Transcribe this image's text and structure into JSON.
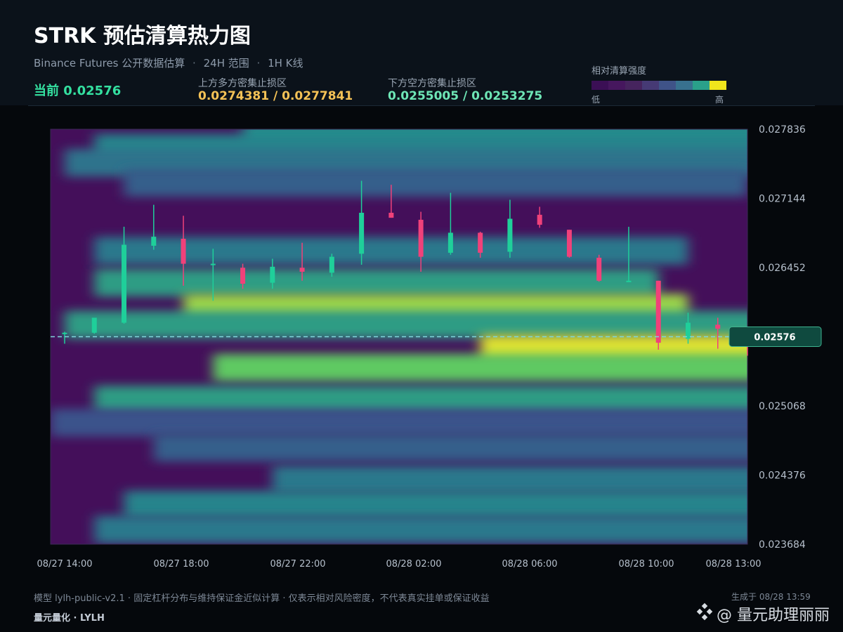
{
  "header": {
    "title": "STRK 预估清算热力图",
    "subtitle_parts": [
      "Binance Futures 公开数据估算",
      "24H 范围",
      "1H K线"
    ],
    "separator": "·",
    "current_label": "当前 0.02576",
    "upper_zone_label": "上方多方密集止损区",
    "upper_zone_value": "0.0274381 / 0.0277841",
    "lower_zone_label": "下方空方密集止损区",
    "lower_zone_value": "0.0255005 / 0.0253275",
    "legend_title": "相对清算强度",
    "legend_low": "低",
    "legend_high": "高"
  },
  "colors": {
    "background": "#05080c",
    "header_bg": "#0b121a",
    "up_candle": "#1fcf9a",
    "down_candle": "#f0417a",
    "current_line": "#7fd6dc",
    "upper_zone": "#f5c256",
    "lower_zone": "#6ee6b6",
    "legend": [
      "#3b0f55",
      "#46175e",
      "#46245e",
      "#463a75",
      "#3f5388",
      "#38718f",
      "#2aa08a",
      "#f0e51c"
    ]
  },
  "footer": {
    "note": "模型 lylh-public-v2.1 · 固定杠杆分布与维持保证金近似计算 · 仅表示相对风险密度，不代表真实挂单或保证收益",
    "generated": "生成于 08/28 13:59",
    "brand": "量元量化 · LYLH",
    "watermark": "@ 量元助理丽丽"
  },
  "chart_data": {
    "type": "heatmap",
    "title": "STRK 预估清算热力图",
    "ylim": [
      0.023684,
      0.027836
    ],
    "y_ticks": [
      "0.027836",
      "0.027144",
      "0.026452",
      "0.025760",
      "0.025068",
      "0.024376",
      "0.023684"
    ],
    "x_ticks": [
      "08/27 14:00",
      "08/27 18:00",
      "08/27 22:00",
      "08/28 02:00",
      "08/28 06:00",
      "08/28 10:00",
      "08/28 13:00"
    ],
    "current_price": 0.02576,
    "current_price_label": "0.02576",
    "candles": [
      {
        "t": "08/27 14:00",
        "o": 0.02579,
        "h": 0.02581,
        "l": 0.02569,
        "c": 0.0258
      },
      {
        "t": "08/27 15:00",
        "o": 0.0258,
        "h": 0.02592,
        "l": 0.02579,
        "c": 0.02595
      },
      {
        "t": "08/27 16:00",
        "o": 0.0259,
        "h": 0.02686,
        "l": 0.02589,
        "c": 0.02668
      },
      {
        "t": "08/27 17:00",
        "o": 0.02667,
        "h": 0.02708,
        "l": 0.02663,
        "c": 0.02676
      },
      {
        "t": "08/27 18:00",
        "o": 0.02674,
        "h": 0.02697,
        "l": 0.02627,
        "c": 0.02649
      },
      {
        "t": "08/27 19:00",
        "o": 0.02648,
        "h": 0.02664,
        "l": 0.02612,
        "c": 0.02649
      },
      {
        "t": "08/27 20:00",
        "o": 0.02645,
        "h": 0.02649,
        "l": 0.02624,
        "c": 0.02629
      },
      {
        "t": "08/27 21:00",
        "o": 0.0263,
        "h": 0.02654,
        "l": 0.02624,
        "c": 0.02646
      },
      {
        "t": "08/27 22:00",
        "o": 0.02645,
        "h": 0.0267,
        "l": 0.02632,
        "c": 0.02641
      },
      {
        "t": "08/27 23:00",
        "o": 0.0264,
        "h": 0.02659,
        "l": 0.02636,
        "c": 0.02656
      },
      {
        "t": "08/28 00:00",
        "o": 0.02659,
        "h": 0.02732,
        "l": 0.02648,
        "c": 0.027
      },
      {
        "t": "08/28 01:00",
        "o": 0.027,
        "h": 0.02728,
        "l": 0.02695,
        "c": 0.02695
      },
      {
        "t": "08/28 02:00",
        "o": 0.02693,
        "h": 0.02701,
        "l": 0.02641,
        "c": 0.02656
      },
      {
        "t": "08/28 03:00",
        "o": 0.0266,
        "h": 0.0272,
        "l": 0.02658,
        "c": 0.0268
      },
      {
        "t": "08/28 04:00",
        "o": 0.0268,
        "h": 0.02681,
        "l": 0.02655,
        "c": 0.0266
      },
      {
        "t": "08/28 05:00",
        "o": 0.02661,
        "h": 0.02713,
        "l": 0.02655,
        "c": 0.02694
      },
      {
        "t": "08/28 06:00",
        "o": 0.02698,
        "h": 0.02706,
        "l": 0.02685,
        "c": 0.02688
      },
      {
        "t": "08/28 07:00",
        "o": 0.02683,
        "h": 0.02683,
        "l": 0.02655,
        "c": 0.02656
      },
      {
        "t": "08/28 08:00",
        "o": 0.02655,
        "h": 0.02658,
        "l": 0.02631,
        "c": 0.02632
      },
      {
        "t": "08/28 09:00",
        "o": 0.02632,
        "h": 0.02686,
        "l": 0.02631,
        "c": 0.02632
      },
      {
        "t": "08/28 10:00",
        "o": 0.02632,
        "h": 0.02632,
        "l": 0.02563,
        "c": 0.0257
      },
      {
        "t": "08/28 11:00",
        "o": 0.02574,
        "h": 0.026,
        "l": 0.02569,
        "c": 0.0259
      },
      {
        "t": "08/28 12:00",
        "o": 0.02588,
        "h": 0.02595,
        "l": 0.02564,
        "c": 0.02584
      },
      {
        "t": "08/28 13:00",
        "o": 0.02579,
        "h": 0.0258,
        "l": 0.02557,
        "c": 0.02576
      }
    ],
    "bands": [
      {
        "price": 0.02776,
        "intensity": 0.5,
        "from": "08/27 21:00",
        "to": "08/28 13:00"
      },
      {
        "price": 0.02765,
        "intensity": 0.45,
        "from": "08/27 16:00",
        "to": "08/28 13:00"
      },
      {
        "price": 0.0275,
        "intensity": 0.38,
        "from": "08/27 15:00",
        "to": "08/28 13:00"
      },
      {
        "price": 0.0273,
        "intensity": 0.3,
        "from": "08/27 17:00",
        "to": "08/28 12:00"
      },
      {
        "price": 0.02662,
        "intensity": 0.4,
        "from": "08/27 16:00",
        "to": "08/28 10:00"
      },
      {
        "price": 0.0263,
        "intensity": 0.55,
        "from": "08/27 16:00",
        "to": "08/28 09:00"
      },
      {
        "price": 0.02605,
        "intensity": 0.85,
        "from": "08/27 19:00",
        "to": "08/28 10:00"
      },
      {
        "price": 0.02588,
        "intensity": 0.55,
        "from": "08/27 15:00",
        "to": "08/28 13:00"
      },
      {
        "price": 0.02564,
        "intensity": 0.95,
        "from": "08/28 05:00",
        "to": "08/28 13:00"
      },
      {
        "price": 0.02545,
        "intensity": 0.75,
        "from": "08/27 20:00",
        "to": "08/28 13:00"
      },
      {
        "price": 0.02513,
        "intensity": 0.55,
        "from": "08/27 16:00",
        "to": "08/28 13:00"
      },
      {
        "price": 0.0249,
        "intensity": 0.25,
        "from": "08/27 14:00",
        "to": "08/28 13:00"
      },
      {
        "price": 0.02465,
        "intensity": 0.3,
        "from": "08/27 18:00",
        "to": "08/28 13:00"
      },
      {
        "price": 0.02433,
        "intensity": 0.4,
        "from": "08/27 22:00",
        "to": "08/28 13:00"
      },
      {
        "price": 0.02408,
        "intensity": 0.45,
        "from": "08/27 17:00",
        "to": "08/28 13:00"
      },
      {
        "price": 0.02383,
        "intensity": 0.4,
        "from": "08/27 16:00",
        "to": "08/28 13:00"
      }
    ]
  }
}
